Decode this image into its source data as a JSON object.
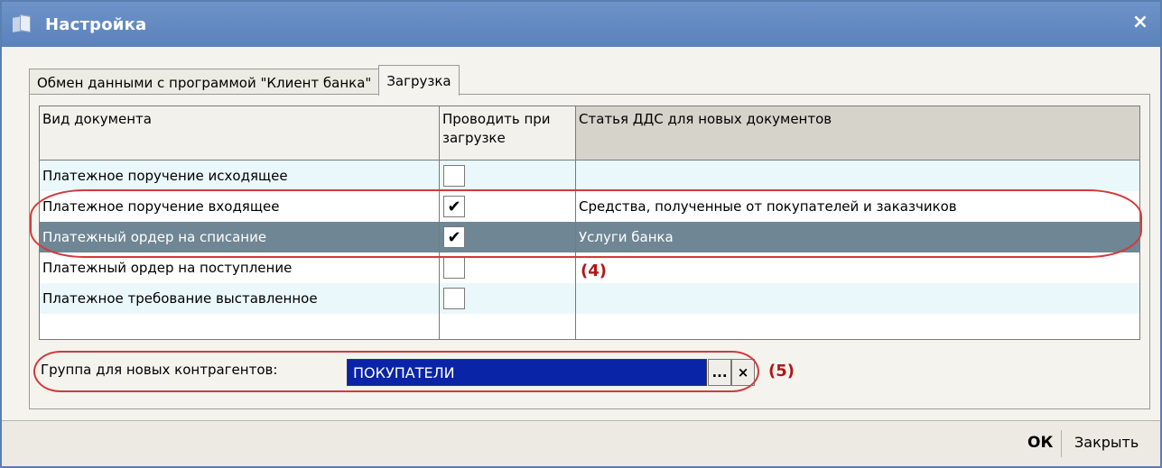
{
  "window": {
    "title": "Настройка",
    "close_glyph": "×"
  },
  "tabs": [
    {
      "label": "Обмен данными с программой \"Клиент банка\"",
      "active": false
    },
    {
      "label": "Загрузка",
      "active": true
    }
  ],
  "grid": {
    "headers": [
      "Вид документа",
      "Проводить при загрузке",
      "Статья ДДС для новых документов"
    ],
    "rows": [
      {
        "doc": "Платежное поручение исходящее",
        "checked": false,
        "article": ""
      },
      {
        "doc": "Платежное поручение входящее",
        "checked": true,
        "article": "Средства, полученные от покупателей и заказчиков"
      },
      {
        "doc": "Платежный ордер на списание",
        "checked": true,
        "article": "Услуги банка"
      },
      {
        "doc": "Платежный ордер на поступление",
        "checked": false,
        "article": ""
      },
      {
        "doc": "Платежное требование выставленное",
        "checked": false,
        "article": ""
      }
    ]
  },
  "counterparty": {
    "label": "Группа для новых контрагентов:",
    "value": "ПОКУПАТЕЛИ",
    "select_button": "...",
    "clear_button": "×"
  },
  "annotations": {
    "rows_label": "(4)",
    "field_label": "(5)",
    "color": "#d23a3a"
  },
  "footer": {
    "ok_label": "ОК",
    "close_label": "Закрыть"
  },
  "check_glyph": "✔"
}
